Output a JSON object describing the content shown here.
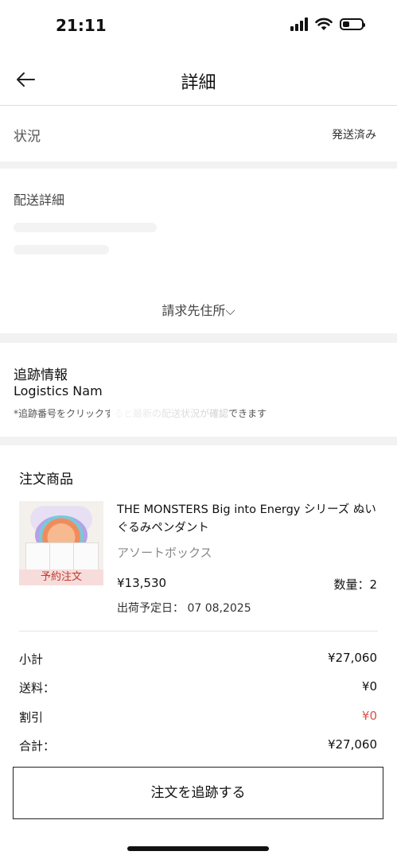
{
  "status_bar": {
    "time": "21:11"
  },
  "header": {
    "title": "詳細"
  },
  "order_status": {
    "label": "状況",
    "value": "発送済み"
  },
  "delivery": {
    "title": "配送詳細",
    "billing_toggle": "請求先住所⌵"
  },
  "tracking": {
    "title": "追跡情報",
    "logistics_name": "Logistics Nam",
    "note": "*追跡番号をクリックすると最新の配送状況が確認できます"
  },
  "order": {
    "title": "注文商品",
    "product": {
      "name": "THE MONSTERS Big into Energy シリーズ ぬいぐるみペンダント",
      "variant": "アソートボックス",
      "badge": "予約注文",
      "price": "¥13,530",
      "quantity": "数量：2",
      "ship_date": "出荷予定日： 07 08,2025"
    },
    "summary": [
      {
        "label": "小計",
        "value": "¥27,060"
      },
      {
        "label": "送料：",
        "value": "¥0"
      },
      {
        "label": "割引",
        "value": "¥0"
      },
      {
        "label": "合計：",
        "value": "¥27,060"
      }
    ],
    "track_button": "注文を追跡する"
  },
  "colors": {
    "discount": "#d9534f",
    "badge_bg": "#f7dcdc"
  }
}
